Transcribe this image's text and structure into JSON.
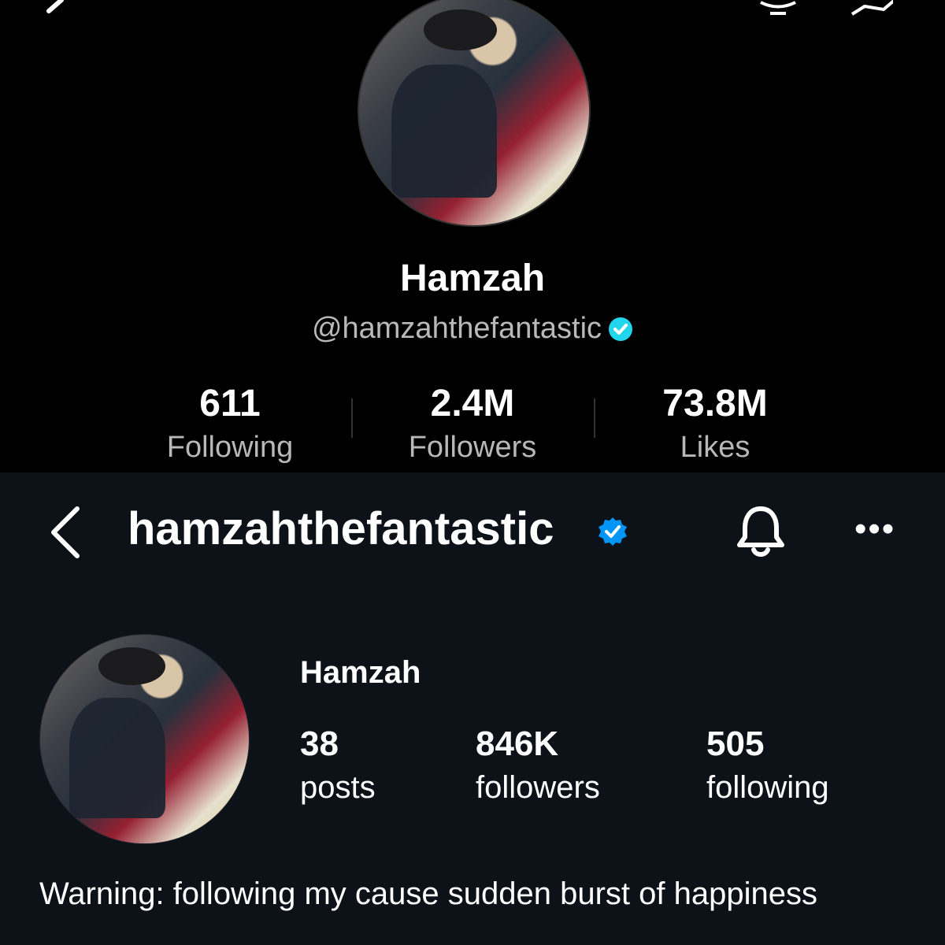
{
  "tiktok": {
    "name": "Hamzah",
    "handle": "@hamzahthefantastic",
    "stats": [
      {
        "value": "611",
        "label": "Following"
      },
      {
        "value": "2.4M",
        "label": "Followers"
      },
      {
        "value": "73.8M",
        "label": "Likes"
      }
    ],
    "icons": [
      "back-icon",
      "bell-icon",
      "share-icon",
      "verified-icon"
    ],
    "verified_color": "#20d5ec"
  },
  "instagram": {
    "username": "hamzahthefantastic",
    "name": "Hamzah",
    "stats": [
      {
        "value": "38",
        "label": "posts"
      },
      {
        "value": "846K",
        "label": "followers"
      },
      {
        "value": "505",
        "label": "following"
      }
    ],
    "bio": "Warning: following my cause sudden burst of happiness",
    "more_label": "•••",
    "icons": [
      "back-icon",
      "verified-icon",
      "bell-icon",
      "more-icon"
    ],
    "verified_color": "#0095f6"
  }
}
